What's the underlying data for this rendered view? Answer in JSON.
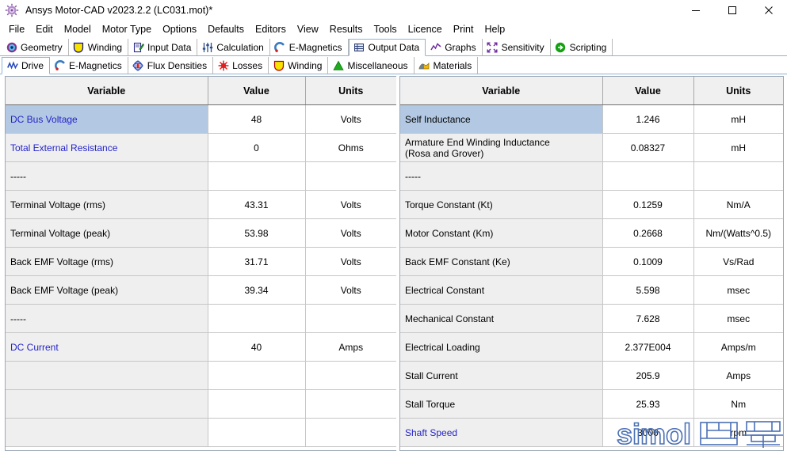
{
  "window": {
    "title": "Ansys Motor-CAD v2023.2.2 (LC031.mot)*",
    "app_icon": "ansys-gear-icon",
    "minimize_label": "—",
    "maximize_label": "□",
    "close_label": "✕"
  },
  "menubar": {
    "items": [
      {
        "label": "File"
      },
      {
        "label": "Edit"
      },
      {
        "label": "Model"
      },
      {
        "label": "Motor Type"
      },
      {
        "label": "Options"
      },
      {
        "label": "Defaults"
      },
      {
        "label": "Editors"
      },
      {
        "label": "View"
      },
      {
        "label": "Results"
      },
      {
        "label": "Tools"
      },
      {
        "label": "Licence"
      },
      {
        "label": "Print"
      },
      {
        "label": "Help"
      }
    ]
  },
  "primary_tabs": {
    "active": "Output Data",
    "items": [
      {
        "label": "Geometry",
        "icon": "target-circle-icon",
        "active": false
      },
      {
        "label": "Winding",
        "icon": "coil-shield-icon",
        "active": false
      },
      {
        "label": "Input Data",
        "icon": "notepad-pencil-icon",
        "active": false
      },
      {
        "label": "Calculation",
        "icon": "sliders-icon",
        "active": false
      },
      {
        "label": "E-Magnetics",
        "icon": "magnet-icon",
        "active": false
      },
      {
        "label": "Output Data",
        "icon": "grid-table-icon",
        "active": true
      },
      {
        "label": "Graphs",
        "icon": "line-chart-icon",
        "active": false
      },
      {
        "label": "Sensitivity",
        "icon": "expand-arrows-icon",
        "active": false
      },
      {
        "label": "Scripting",
        "icon": "green-arrow-icon",
        "active": false
      }
    ]
  },
  "secondary_tabs": {
    "active": "Drive",
    "items": [
      {
        "label": "Drive",
        "icon": "waveform-icon",
        "active": true
      },
      {
        "label": "E-Magnetics",
        "icon": "magnet-icon",
        "active": false
      },
      {
        "label": "Flux Densities",
        "icon": "flux-field-icon",
        "active": false
      },
      {
        "label": "Losses",
        "icon": "red-sun-icon",
        "active": false
      },
      {
        "label": "Winding",
        "icon": "coil-shield-icon",
        "active": false
      },
      {
        "label": "Miscellaneous",
        "icon": "green-triangle-icon",
        "active": false
      },
      {
        "label": "Materials",
        "icon": "materials-icon",
        "active": false
      }
    ]
  },
  "tables": {
    "headers": {
      "variable": "Variable",
      "value": "Value",
      "units": "Units"
    },
    "left_rows": [
      {
        "variable": "DC Bus Voltage",
        "value": "48",
        "units": "Volts",
        "selected": true,
        "link": true
      },
      {
        "variable": "Total External Resistance",
        "value": "0",
        "units": "Ohms",
        "selected": false,
        "link": true
      },
      {
        "variable": "-----",
        "value": "",
        "units": "",
        "selected": false,
        "link": false
      },
      {
        "variable": "Terminal Voltage (rms)",
        "value": "43.31",
        "units": "Volts",
        "selected": false,
        "link": false
      },
      {
        "variable": "Terminal Voltage (peak)",
        "value": "53.98",
        "units": "Volts",
        "selected": false,
        "link": false
      },
      {
        "variable": "Back EMF Voltage (rms)",
        "value": "31.71",
        "units": "Volts",
        "selected": false,
        "link": false
      },
      {
        "variable": "Back EMF Voltage (peak)",
        "value": "39.34",
        "units": "Volts",
        "selected": false,
        "link": false
      },
      {
        "variable": "-----",
        "value": "",
        "units": "",
        "selected": false,
        "link": false
      },
      {
        "variable": "DC Current",
        "value": "40",
        "units": "Amps",
        "selected": false,
        "link": true
      },
      {
        "variable": "",
        "value": "",
        "units": "",
        "selected": false,
        "link": false
      },
      {
        "variable": "",
        "value": "",
        "units": "",
        "selected": false,
        "link": false
      },
      {
        "variable": "",
        "value": "",
        "units": "",
        "selected": false,
        "link": false
      }
    ],
    "right_rows": [
      {
        "variable": "Self Inductance",
        "variable2": "",
        "value": "1.246",
        "units": "mH",
        "selected": true,
        "link": false
      },
      {
        "variable": "Armature End Winding Inductance",
        "variable2": "(Rosa and Grover)",
        "value": "0.08327",
        "units": "mH",
        "selected": false,
        "link": false
      },
      {
        "variable": "-----",
        "variable2": "",
        "value": "",
        "units": "",
        "selected": false,
        "link": false
      },
      {
        "variable": "Torque Constant (Kt)",
        "variable2": "",
        "value": "0.1259",
        "units": "Nm/A",
        "selected": false,
        "link": false
      },
      {
        "variable": "Motor Constant (Km)",
        "variable2": "",
        "value": "0.2668",
        "units": "Nm/(Watts^0.5)",
        "selected": false,
        "link": false
      },
      {
        "variable": "Back EMF Constant (Ke)",
        "variable2": "",
        "value": "0.1009",
        "units": "Vs/Rad",
        "selected": false,
        "link": false
      },
      {
        "variable": "Electrical Constant",
        "variable2": "",
        "value": "5.598",
        "units": "msec",
        "selected": false,
        "link": false
      },
      {
        "variable": "Mechanical Constant",
        "variable2": "",
        "value": "7.628",
        "units": "msec",
        "selected": false,
        "link": false
      },
      {
        "variable": "Electrical Loading",
        "variable2": "",
        "value": "2.377E004",
        "units": "Amps/m",
        "selected": false,
        "link": false
      },
      {
        "variable": "Stall Current",
        "variable2": "",
        "value": "205.9",
        "units": "Amps",
        "selected": false,
        "link": false
      },
      {
        "variable": "Stall Torque",
        "variable2": "",
        "value": "25.93",
        "units": "Nm",
        "selected": false,
        "link": false
      },
      {
        "variable": "Shaft Speed",
        "variable2": "",
        "value": "3000",
        "units": "rpm",
        "selected": false,
        "link": true
      }
    ]
  },
  "watermark": {
    "latin_text": "simol",
    "cjk_text": "西莫",
    "color": "#4a6fb5"
  },
  "colors": {
    "selection": "#b3c9e3",
    "link": "#2323c8",
    "header_bg": "#f0f0f0",
    "variable_cell_bg": "#efefef",
    "tab_border": "#8ab4d8"
  }
}
